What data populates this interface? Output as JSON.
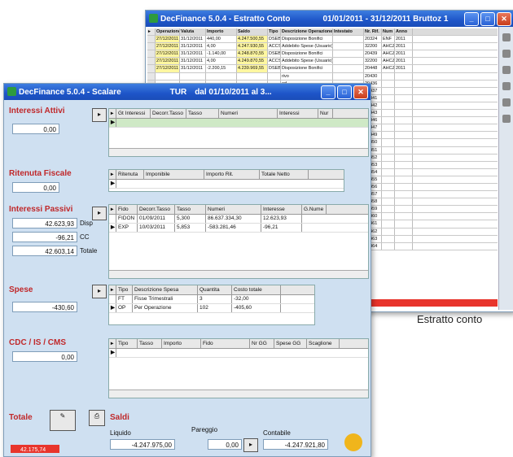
{
  "back_window": {
    "title": "DecFinance 5.0.4 - Estratto Conto",
    "title_right": "01/01/2011 - 31/12/2011 Bruttoz 1",
    "columns": [
      "Operazione",
      "Valuta",
      "Importo",
      "Saldo",
      "Tipo",
      "Descrizione Operazione",
      "Intestato",
      "Nr. Rif.",
      "Num",
      "Anno"
    ],
    "rows": [
      {
        "op": "27/12/2011",
        "val": "31/12/2011",
        "imp": "440,00",
        "saldo": "4.247.500,55",
        "tipo": "DSEB",
        "desc": "Disposizione Bonifici",
        "rif": "20324",
        "num": "ENF",
        "anno": "2011"
      },
      {
        "op": "27/12/2011",
        "val": "31/12/2011",
        "imp": "4,00",
        "saldo": "4.247.930,55",
        "tipo": "ACCSP",
        "desc": "Addebito Spese (Usuario)",
        "rif": "32200",
        "num": "AHCZ",
        "anno": "2011"
      },
      {
        "op": "27/12/2011",
        "val": "31/12/2011",
        "imp": "-1.140,00",
        "saldo": "4.248.870,55",
        "tipo": "DSEB",
        "desc": "Disposizione Bonifici",
        "rif": "20439",
        "num": "AHCZ",
        "anno": "2011"
      },
      {
        "op": "27/12/2011",
        "val": "31/12/2011",
        "imp": "4,00",
        "saldo": "4.249.870,55",
        "tipo": "ACCSP",
        "desc": "Addebito Spese (Usuario)",
        "rif": "32200",
        "num": "AHCZ",
        "anno": "2011"
      },
      {
        "op": "27/12/2011",
        "val": "31/12/2011",
        "imp": "-2.200,15",
        "saldo": "4.239.969,55",
        "tipo": "DSEB",
        "desc": "Disposizione Bonifici",
        "rif": "20448",
        "num": "AHCZ",
        "anno": "2011"
      }
    ],
    "more_rows": [
      "rivo",
      "ed",
      "rivo",
      "(Usuario)",
      "ivid",
      "(Usuario)",
      "ivid",
      "(Usuario)",
      "erirevizione",
      "(Usuario)",
      "ivid",
      "(Usuario)",
      "ivid",
      "(Usuario)",
      "ivid",
      "(Usuario)",
      "ivid",
      "(Usuario)",
      "rivo",
      "ivid",
      "ivid",
      "ivid",
      "ivid",
      "ivid"
    ],
    "more_rif": [
      "20430",
      "20436",
      "20437",
      "20441",
      "20442",
      "20443",
      "20446",
      "20447",
      "20449",
      "20450",
      "20451",
      "20452",
      "20453",
      "20454",
      "20455",
      "20456",
      "20457",
      "20458",
      "20459",
      "20460",
      "20461",
      "20462",
      "20463",
      "20464"
    ],
    "caption": "Estratto conto"
  },
  "front_window": {
    "title": "DecFinance 5.0.4 - Scalare",
    "title_mid": "TUR",
    "title_right": "dal 01/10/2011 al 3...",
    "interessi_attivi": {
      "label": "Interessi Attivi",
      "value": "0,00",
      "columns": [
        "Gt Interessi",
        "Decorr.Tasso",
        "Tasso",
        "Numeri",
        "Interessi",
        "Nur"
      ]
    },
    "ritenuta": {
      "label": "Ritenuta Fiscale",
      "value": "0,00",
      "columns": [
        "Ritenuta",
        "Imponibile",
        "Importo Rit.",
        "Totale Netto"
      ]
    },
    "interessi_passivi": {
      "label": "Interessi Passivi",
      "values": [
        "42.623,93",
        "-96,21",
        "42.603,14"
      ],
      "labels": [
        "Disp",
        "CC",
        "Totale"
      ],
      "columns": [
        "Fido",
        "Decorr.Tasso",
        "Tasso",
        "Numeri",
        "Interesse",
        "G.Nume"
      ],
      "rows": [
        [
          "FIDON",
          "01/09/2011",
          "5,300",
          "86.637.334,30",
          "12.623,93"
        ],
        [
          "EXP",
          "10/03/2011",
          "5,853",
          "-583.281,46",
          "-96,21"
        ]
      ]
    },
    "spese": {
      "label": "Spese",
      "value": "-430,60",
      "columns": [
        "Tipo",
        "Descrizione Spesa",
        "Quantita",
        "Costo totale"
      ],
      "rows": [
        [
          "FT",
          "Fisse Trimestrali",
          "3",
          "-32,00"
        ],
        [
          "OP",
          "Per Operazione",
          "102",
          "-405,60"
        ]
      ]
    },
    "cdc": {
      "label": "CDC / IS / CMS",
      "value": "0,00",
      "columns": [
        "Tipo",
        "Tasso",
        "Importo",
        "Fido",
        "Nr GG",
        "Spese GG",
        "Scaglione"
      ]
    },
    "totale": {
      "label": "Totale",
      "value": "42.175,74"
    },
    "saldi": {
      "label": "Saldi",
      "liquido_label": "Liquido",
      "liquido": "-4.247.975,00",
      "pareggio_label": "Pareggio",
      "pareggio": "0,00",
      "contabile_label": "Contabile",
      "contabile": "-4.247.921,80"
    }
  }
}
